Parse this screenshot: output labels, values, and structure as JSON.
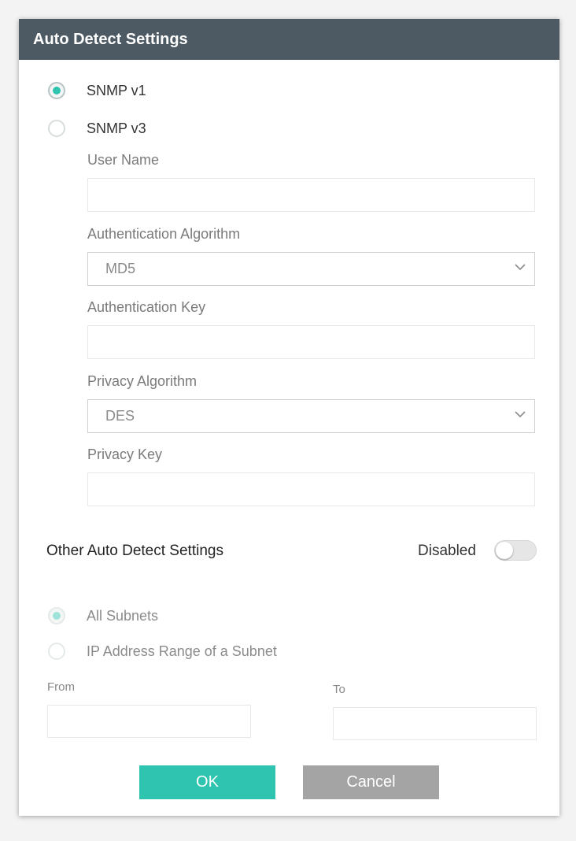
{
  "dialog": {
    "title": "Auto Detect Settings"
  },
  "snmp": {
    "v1_label": "SNMP v1",
    "v3_label": "SNMP v3",
    "selected": "SNMP v1"
  },
  "fields": {
    "user_name_label": "User Name",
    "user_name_value": "",
    "auth_algorithm_label": "Authentication Algorithm",
    "auth_algorithm_value": "MD5",
    "auth_key_label": "Authentication Key",
    "auth_key_value": "",
    "privacy_algorithm_label": "Privacy Algorithm",
    "privacy_algorithm_value": "DES",
    "privacy_key_label": "Privacy Key",
    "privacy_key_value": ""
  },
  "other": {
    "label": "Other Auto Detect Settings",
    "toggle_label": "Disabled",
    "toggle_on": false
  },
  "subnet": {
    "all_label": "All Subnets",
    "range_label": "IP Address Range of a Subnet",
    "selected": "All Subnets",
    "from_label": "From",
    "from_value": "",
    "to_label": "To",
    "to_value": ""
  },
  "buttons": {
    "ok_label": "OK",
    "cancel_label": "Cancel"
  },
  "colors": {
    "accent": "#2ec4b0",
    "titlebar": "#4d5a64",
    "cancel_button": "#a4a4a4"
  },
  "icons": {
    "select_arrow": "chevron-down-icon"
  }
}
